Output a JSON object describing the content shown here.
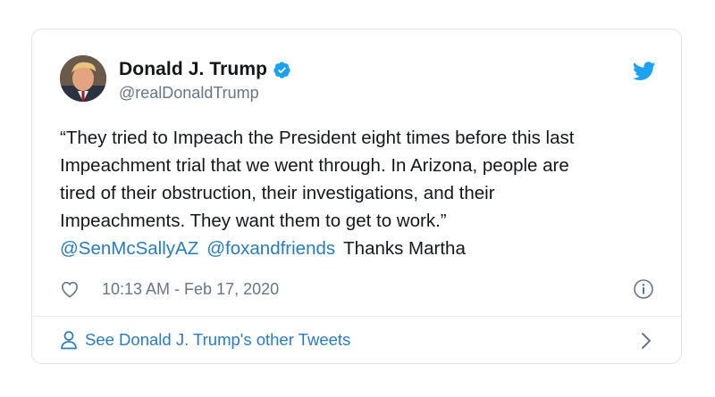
{
  "tweet": {
    "author": {
      "display_name": "Donald J. Trump",
      "handle": "@realDonaldTrump",
      "verified": true,
      "avatar_icon": "avatar-photo"
    },
    "text_lines": [
      "“They tried to Impeach the President eight times before this last",
      "Impeachment trial that we went through. In Arizona, people are",
      "tired of their obstruction, their investigations, and their",
      "Impeachments. They want them to get to work.”"
    ],
    "mentions": [
      "@SenMcSallyAZ",
      "@foxandfriends"
    ],
    "trailing_text": "Thanks Martha",
    "timestamp": "10:13 AM - Feb 17, 2020",
    "footer_link": "See Donald J. Trump's other Tweets"
  },
  "colors": {
    "link": "#2b7bb9",
    "twitter_blue": "#1da1f2",
    "muted": "#657786",
    "text": "#14171a",
    "border": "#dfe3e7"
  },
  "icons": {
    "logo": "twitter-bird-icon",
    "verified": "verified-badge-icon",
    "like": "heart-icon",
    "info": "info-icon",
    "profile": "person-icon",
    "more": "chevron-right-icon"
  }
}
